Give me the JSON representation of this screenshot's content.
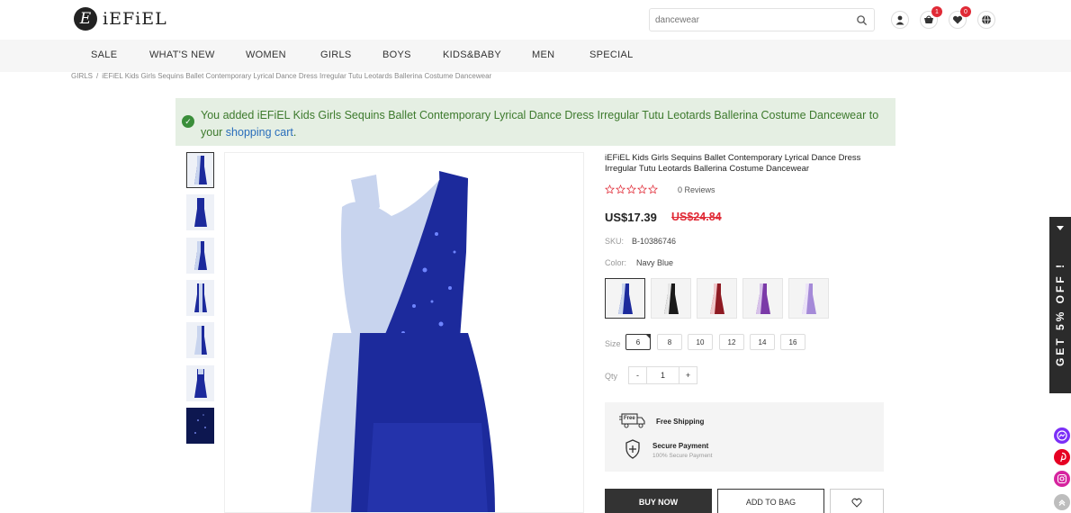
{
  "header": {
    "logo_text": "iEFiEL",
    "logo_mark": "E",
    "search_placeholder": "dancewear",
    "cart_count": "1",
    "wishlist_count": "0"
  },
  "nav": [
    "SALE",
    "WHAT'S NEW",
    "WOMEN",
    "GIRLS",
    "BOYS",
    "KIDS&BABY",
    "MEN",
    "SPECIAL"
  ],
  "breadcrumb": {
    "parent": "GIRLS",
    "separator": "/",
    "current": "iEFiEL Kids Girls Sequins Ballet Contemporary Lyrical Dance Dress Irregular Tutu Leotards Ballerina Costume Dancewear"
  },
  "notice": {
    "prefix": "You added iEFiEL Kids Girls Sequins Ballet Contemporary Lyrical Dance Dress Irregular Tutu Leotards Ballerina Costume Dancewear to your ",
    "link": "shopping cart",
    "suffix": "."
  },
  "product": {
    "title": "iEFiEL Kids Girls Sequins Ballet Contemporary Lyrical Dance Dress Irregular Tutu Leotards Ballerina Costume Dancewear",
    "reviews": "0 Reviews",
    "rating": 0,
    "price": "US$17.39",
    "old_price": "US$24.84",
    "sku_label": "SKU:",
    "sku": "B-10386746",
    "color_label": "Color:",
    "color": "Navy Blue",
    "size_label": "Size",
    "sizes": [
      "6",
      "8",
      "10",
      "12",
      "14",
      "16"
    ],
    "qty_label": "Qty",
    "qty_minus": "-",
    "qty": "1",
    "qty_plus": "+",
    "swatch_colors": [
      "#1c2a9c",
      "#1a1a1a",
      "#8e1a22",
      "#7b3aa8",
      "#a58ad8"
    ]
  },
  "services": {
    "free_badge": "Free",
    "shipping": "Free Shipping",
    "payment": "Secure Payment",
    "payment_sub": "100% Secure Payment"
  },
  "buttons": {
    "buy_now": "BUY NOW",
    "add_to_bag": "ADD TO BAG"
  },
  "promo": "GET 5% OFF !",
  "colors": {
    "accent_red": "#e02a36",
    "notice_bg": "#e5efe3",
    "notice_text": "#3d7a2d",
    "link_blue": "#2a6ebb",
    "dress_navy": "#1c2a9c",
    "dress_light": "#c8d4ee"
  }
}
